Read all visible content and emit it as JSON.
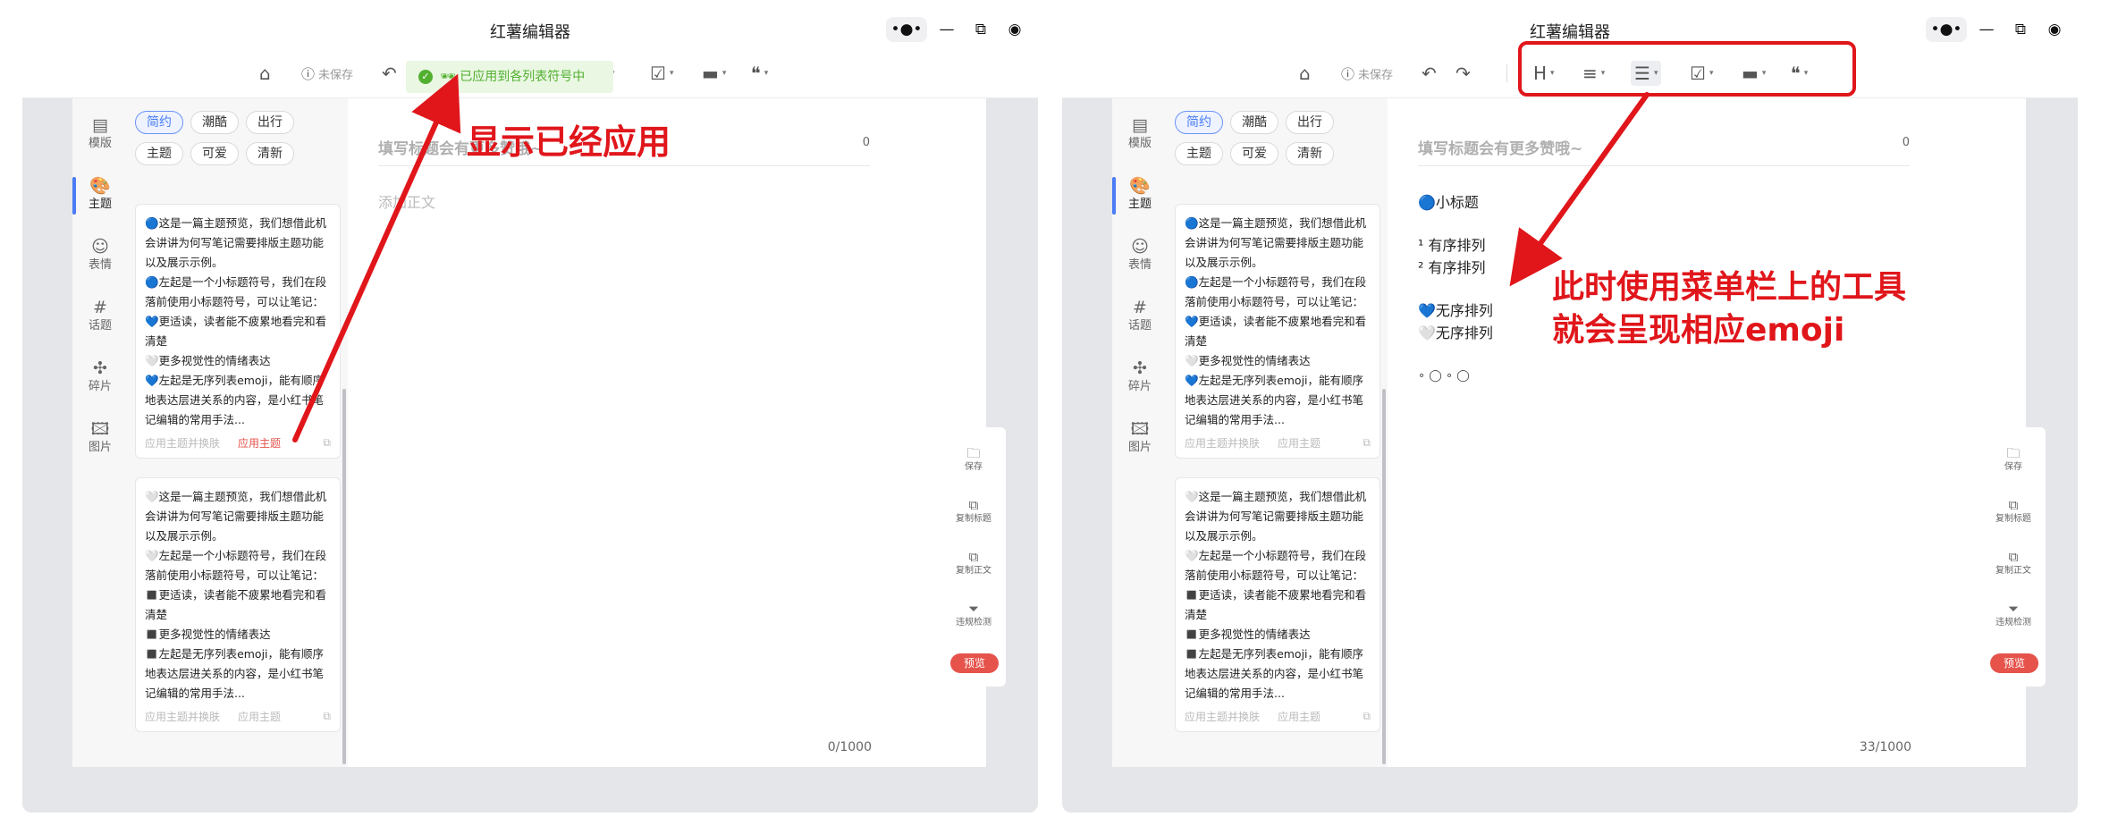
{
  "app": {
    "title": "红薯编辑器",
    "unsaved": "未保存"
  },
  "nav": [
    {
      "label": "模版",
      "icon": "template-icon"
    },
    {
      "label": "主题",
      "icon": "palette-icon"
    },
    {
      "label": "表情",
      "icon": "smiley-icon"
    },
    {
      "label": "话题",
      "icon": "hashtag-icon"
    },
    {
      "label": "碎片",
      "icon": "puzzle-icon"
    },
    {
      "label": "图片",
      "icon": "image-icon"
    }
  ],
  "themes": [
    "简约",
    "潮酷",
    "出行",
    "主题",
    "可爱",
    "清新"
  ],
  "cards": [
    {
      "lines": [
        "🔵这是一篇主题预览，我们想借此机",
        "会讲讲为何写笔记需要排版主题功能",
        "以及展示示例。",
        "🔵左起是一个小标题符号，我们在段",
        "落前使用小标题符号，可以让笔记：",
        "💙更适读，读者能不疲累地看完和看",
        "清楚",
        "🤍更多视觉性的情绪表达",
        "💙左起是无序列表emoji，能有顺序",
        "地表达层进关系的内容，是小红书笔",
        "记编辑的常用手法..."
      ],
      "swap": "应用主题并换肤",
      "apply": "应用主题"
    },
    {
      "lines": [
        "🤍这是一篇主题预览，我们想借此机",
        "会讲讲为何写笔记需要排版主题功能",
        "以及展示示例。",
        "🤍左起是一个小标题符号，我们在段",
        "落前使用小标题符号，可以让笔记：",
        "◼️更适读，读者能不疲累地看完和看",
        "清楚",
        "◼️更多视觉性的情绪表达",
        "◼️左起是无序列表emoji，能有顺序",
        "地表达层进关系的内容，是小红书笔",
        "记编辑的常用手法..."
      ],
      "swap": "应用主题并换肤",
      "apply": "应用主题"
    }
  ],
  "editor_left": {
    "title_placeholder": "填写标题会有更多赞哦~",
    "title_count": "0",
    "body_placeholder": "添加正文",
    "body_count": "0/1000"
  },
  "editor_right": {
    "title_placeholder": "填写标题会有更多赞哦~",
    "title_count": "0",
    "body": {
      "heading": "🔵小标题",
      "ordered": [
        "¹ 有序排列",
        "² 有序排列"
      ],
      "unordered": [
        "💙无序排列",
        "🤍无序排列"
      ],
      "circles": "∘ ◯ ∘ ◯"
    },
    "body_count": "33/1000"
  },
  "side_actions": [
    {
      "label": "保存",
      "icon": "save-icon"
    },
    {
      "label": "复制标题",
      "icon": "copy-title-icon"
    },
    {
      "label": "复制正文",
      "icon": "copy-body-icon"
    },
    {
      "label": "违规检测",
      "icon": "filter-icon"
    }
  ],
  "preview": "预览",
  "toast": "🕶 已应用到各列表符号中",
  "annotations": {
    "left": "显示已经应用",
    "right_1": "此时使用菜单栏上的工具",
    "right_2": "就会呈现相应emoji"
  },
  "colors": {
    "accent_blue": "#4a7cf6",
    "annotation_red": "#e0161b",
    "preview_red": "#e5534b",
    "toast_green": "#52b030"
  }
}
